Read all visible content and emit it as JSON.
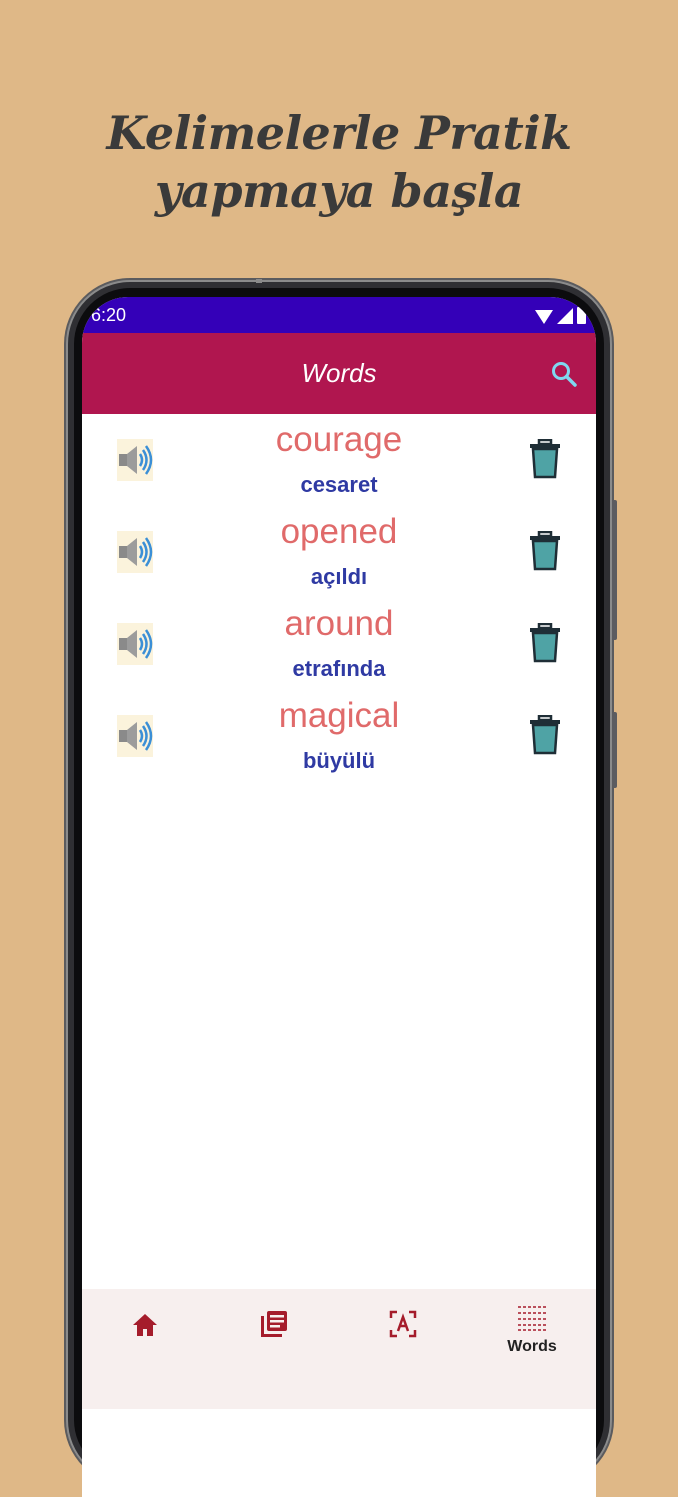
{
  "promo": {
    "headline_line1": "Kelimelerle Pratik",
    "headline_line2": "yapmaya başla"
  },
  "status_bar": {
    "time": "6:20"
  },
  "app_bar": {
    "title": "Words"
  },
  "words": [
    {
      "word": "courage",
      "translation": "cesaret"
    },
    {
      "word": "opened",
      "translation": "açıldı"
    },
    {
      "word": "around",
      "translation": "etrafında"
    },
    {
      "word": "magical",
      "translation": "büyülü"
    }
  ],
  "bottom_nav": {
    "items": [
      {
        "icon": "home-icon",
        "label": ""
      },
      {
        "icon": "library-icon",
        "label": ""
      },
      {
        "icon": "translate-scan-icon",
        "label": ""
      },
      {
        "icon": "words-grid-icon",
        "label": "Words",
        "active": true
      }
    ]
  },
  "colors": {
    "page_background": "#dfb887",
    "status_bar": "#3400b8",
    "app_bar": "#b0164f",
    "word_text": "#e06a6a",
    "translation_text": "#2f3aa3",
    "search_icon": "#7fd8f0",
    "trash_icon": "#4fa3a5",
    "nav_icon": "#a51c2b"
  }
}
